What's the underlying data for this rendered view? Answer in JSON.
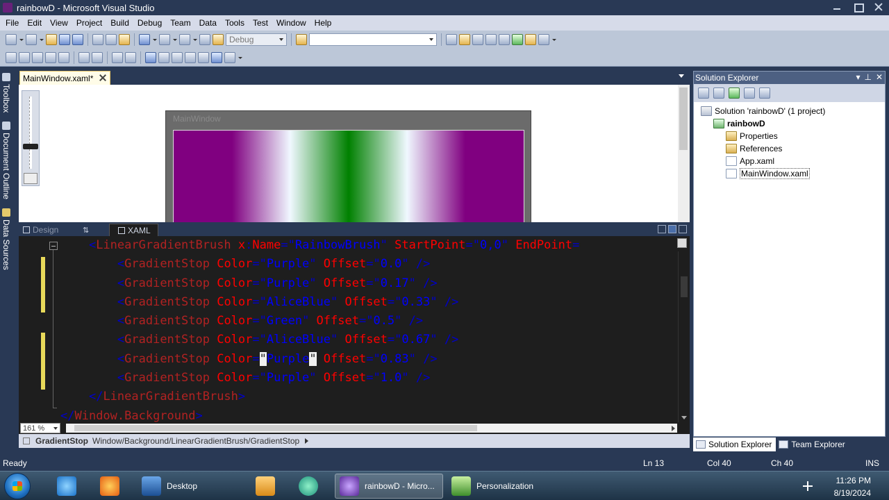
{
  "window": {
    "title": "rainbowD - Microsoft Visual Studio"
  },
  "menu": [
    "File",
    "Edit",
    "View",
    "Project",
    "Build",
    "Debug",
    "Team",
    "Data",
    "Tools",
    "Test",
    "Window",
    "Help"
  ],
  "toolbar": {
    "config_select": "Debug",
    "find_select": ""
  },
  "left_strip": {
    "toolbox": "Toolbox",
    "document_outline": "Document Outline",
    "data_sources": "Data Sources"
  },
  "doc_tab": {
    "label": "MainWindow.xaml*"
  },
  "designer": {
    "window_title": "MainWindow",
    "gradient_colors": [
      "#800080",
      "#800080",
      "#f0f8ff",
      "#008000",
      "#f0f8ff",
      "#800080",
      "#800080"
    ]
  },
  "split": {
    "design_tab": "Design",
    "xaml_tab": "XAML"
  },
  "code_lines": [
    {
      "indent": "    ",
      "parts": [
        [
          "b",
          "<"
        ],
        [
          "e",
          "LinearGradientBrush"
        ],
        [
          "a",
          " x"
        ],
        [
          "b",
          ":"
        ],
        [
          "a",
          "Name"
        ],
        [
          "b",
          "=\""
        ],
        [
          "v",
          "RainbowBrush"
        ],
        [
          "b",
          "\""
        ],
        [
          "a",
          " StartPoint"
        ],
        [
          "b",
          "=\""
        ],
        [
          "v",
          "0,0"
        ],
        [
          "b",
          "\""
        ],
        [
          "a",
          " EndPoint"
        ],
        [
          "b",
          "="
        ]
      ]
    },
    {
      "indent": "        ",
      "parts": [
        [
          "b",
          "<"
        ],
        [
          "e",
          "GradientStop"
        ],
        [
          "a",
          " Color"
        ],
        [
          "b",
          "=\""
        ],
        [
          "v",
          "Purple"
        ],
        [
          "b",
          "\""
        ],
        [
          "a",
          " Offset"
        ],
        [
          "b",
          "=\""
        ],
        [
          "v",
          "0.0"
        ],
        [
          "b",
          "\""
        ],
        [
          "b",
          " />"
        ]
      ]
    },
    {
      "indent": "        ",
      "parts": [
        [
          "b",
          "<"
        ],
        [
          "e",
          "GradientStop"
        ],
        [
          "a",
          " Color"
        ],
        [
          "b",
          "=\""
        ],
        [
          "v",
          "Purple"
        ],
        [
          "b",
          "\""
        ],
        [
          "a",
          " Offset"
        ],
        [
          "b",
          "=\""
        ],
        [
          "v",
          "0.17"
        ],
        [
          "b",
          "\""
        ],
        [
          "b",
          " />"
        ]
      ]
    },
    {
      "indent": "        ",
      "parts": [
        [
          "b",
          "<"
        ],
        [
          "e",
          "GradientStop"
        ],
        [
          "a",
          " Color"
        ],
        [
          "b",
          "=\""
        ],
        [
          "v",
          "AliceBlue"
        ],
        [
          "b",
          "\""
        ],
        [
          "a",
          " Offset"
        ],
        [
          "b",
          "=\""
        ],
        [
          "v",
          "0.33"
        ],
        [
          "b",
          "\""
        ],
        [
          "b",
          " />"
        ]
      ]
    },
    {
      "indent": "        ",
      "parts": [
        [
          "b",
          "<"
        ],
        [
          "e",
          "GradientStop"
        ],
        [
          "a",
          " Color"
        ],
        [
          "b",
          "=\""
        ],
        [
          "v",
          "Green"
        ],
        [
          "b",
          "\""
        ],
        [
          "a",
          " Offset"
        ],
        [
          "b",
          "=\""
        ],
        [
          "v",
          "0.5"
        ],
        [
          "b",
          "\""
        ],
        [
          "b",
          " />"
        ]
      ]
    },
    {
      "indent": "        ",
      "parts": [
        [
          "b",
          "<"
        ],
        [
          "e",
          "GradientStop"
        ],
        [
          "a",
          " Color"
        ],
        [
          "b",
          "=\""
        ],
        [
          "v",
          "AliceBlue"
        ],
        [
          "b",
          "\""
        ],
        [
          "a",
          " Offset"
        ],
        [
          "b",
          "=\""
        ],
        [
          "v",
          "0.67"
        ],
        [
          "b",
          "\""
        ],
        [
          "b",
          " />"
        ]
      ]
    },
    {
      "indent": "        ",
      "parts": [
        [
          "b",
          "<"
        ],
        [
          "e",
          "GradientStop"
        ],
        [
          "a",
          " Color"
        ],
        [
          "b",
          "="
        ],
        [
          "sel",
          "\""
        ],
        [
          "v",
          "Purple"
        ],
        [
          "sel",
          "\""
        ],
        [
          "a",
          " Offset"
        ],
        [
          "b",
          "=\""
        ],
        [
          "v",
          "0.83"
        ],
        [
          "b",
          "\""
        ],
        [
          "b",
          " />"
        ]
      ]
    },
    {
      "indent": "        ",
      "parts": [
        [
          "b",
          "<"
        ],
        [
          "e",
          "GradientStop"
        ],
        [
          "a",
          " Color"
        ],
        [
          "b",
          "=\""
        ],
        [
          "v",
          "Purple"
        ],
        [
          "b",
          "\""
        ],
        [
          "a",
          " Offset"
        ],
        [
          "b",
          "=\""
        ],
        [
          "v",
          "1.0"
        ],
        [
          "b",
          "\""
        ],
        [
          "b",
          " />"
        ]
      ]
    },
    {
      "indent": "    ",
      "parts": [
        [
          "b",
          "</"
        ],
        [
          "e",
          "LinearGradientBrush"
        ],
        [
          "b",
          ">"
        ]
      ]
    },
    {
      "indent": "",
      "parts": [
        [
          "b",
          "</"
        ],
        [
          "e",
          "Window.Background"
        ],
        [
          "b",
          ">"
        ]
      ]
    }
  ],
  "editor_zoom": "161 %",
  "pathbar": {
    "element": "GradientStop",
    "path": "Window/Background/LinearGradientBrush/GradientStop"
  },
  "solution_explorer": {
    "title": "Solution Explorer",
    "tree": [
      {
        "label": "Solution 'rainbowD' (1 project)",
        "icon": "sol",
        "level": 0
      },
      {
        "label": "rainbowD",
        "icon": "proj",
        "level": 1,
        "bold": true
      },
      {
        "label": "Properties",
        "icon": "folder",
        "level": 2
      },
      {
        "label": "References",
        "icon": "folder",
        "level": 2
      },
      {
        "label": "App.xaml",
        "icon": "file",
        "level": 2
      },
      {
        "label": "MainWindow.xaml",
        "icon": "file",
        "level": 2,
        "selected": true
      }
    ],
    "bottom_tabs": [
      "Solution Explorer",
      "Team Explorer"
    ]
  },
  "status": {
    "left": "Ready",
    "ln": "Ln 13",
    "col": "Col 40",
    "ch": "Ch 40",
    "mode": "INS"
  },
  "taskbar": {
    "items": [
      "",
      "",
      "Desktop",
      "",
      "",
      "rainbowD - Micro...",
      "Personalization"
    ],
    "time": "11:26 PM",
    "date": "8/19/2024"
  }
}
